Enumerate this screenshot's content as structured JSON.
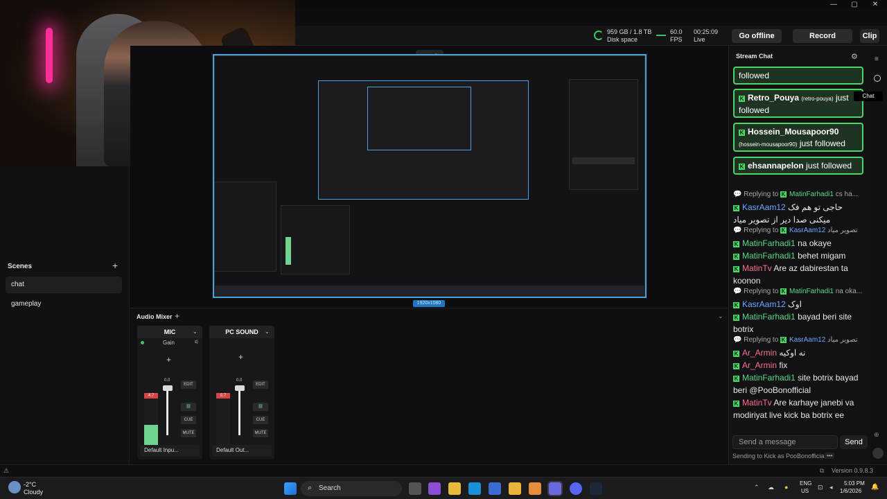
{
  "window": {
    "minimize": "—",
    "maximize": "▢",
    "close": "✕"
  },
  "toolbar": {
    "disk_value": "959 GB / 1.8 TB",
    "disk_label": "Disk space",
    "fps_value": "60.0",
    "fps_label": "FPS",
    "time_value": "00:25:09",
    "time_label": "Live",
    "go_offline": "Go offline",
    "record": "Record",
    "clip": "Clip"
  },
  "scenes": {
    "title": "Scenes",
    "add": "+",
    "items": [
      {
        "label": "chat"
      },
      {
        "label": "gameplay"
      }
    ]
  },
  "preview": {
    "resolution": "1920x1080"
  },
  "mixer": {
    "title": "Audio Mixer",
    "add": "+",
    "collapse": "⌄",
    "strips": [
      {
        "name": "MIC",
        "gain": "Gain",
        "add": "+",
        "peak": "4.7",
        "level": "0.0",
        "edit": "EDIT",
        "cue": "CUE",
        "mute": "MUTE",
        "device": "Default Inpu...",
        "meter_fill": 0.52
      },
      {
        "name": "PC SOUND",
        "add": "+",
        "peak": "0.7",
        "level": "0.0",
        "edit": "EDIT",
        "cue": "CUE",
        "mute": "MUTE",
        "device": "Default Out...",
        "meter_fill": 0.05
      }
    ]
  },
  "chat": {
    "title": "Stream Chat",
    "tooltip": "Chat",
    "follows": [
      {
        "tail": "followed"
      },
      {
        "user": "Retro_Pouya",
        "handle": "(retro-pouya)",
        "tail": "just followed"
      },
      {
        "user": "Hossein_Mousapoor90",
        "handle": "(hossein-mousapoor90)",
        "tail": "just followed"
      },
      {
        "user": "ehsannapelon",
        "tail": "just followed"
      }
    ],
    "messages": [
      {
        "reply_to": "MatinFarhadi1",
        "reply_text": "cs ha..."
      },
      {
        "user": "KasrAam12",
        "text": "حاجی تو هم فک میکنی صدا دیر از تصویر میاد"
      },
      {
        "reply_to": "KasrAam12",
        "reply_text": "تصویر میاد"
      },
      {
        "user": "MatinFarhadi1",
        "text": "na okaye"
      },
      {
        "user": "MatinFarhadi1",
        "text": "behet migam"
      },
      {
        "user": "MatinTv",
        "text": "Are az dabirestan ta koonon"
      },
      {
        "reply_to": "MatinFarhadi1",
        "reply_text": "na oka..."
      },
      {
        "user": "KasrAam12",
        "text": "اوک"
      },
      {
        "user": "MatinFarhadi1",
        "text": "bayad beri site botrix"
      },
      {
        "reply_to": "KasrAam12",
        "reply_text": "تصویر میاد"
      },
      {
        "user": "Ar_Armin",
        "text": "نه اوکیه"
      },
      {
        "user": "Ar_Armin",
        "text": "fix"
      },
      {
        "user": "MatinFarhadi1",
        "text": "site botrix bayad beri @PooBonofficial"
      },
      {
        "user": "MatinTv",
        "text": "Are karhaye janebi va modiriyat live kick ba botrix ee"
      }
    ],
    "replying_label": "Replying to",
    "input_placeholder": "Send a message",
    "send": "Send",
    "sending_as": "Sending to Kick as PooBonofficial.",
    "more": "•••"
  },
  "status": {
    "version": "Version 0.9.8.3"
  },
  "taskbar": {
    "weather_temp": "-2°C",
    "weather_desc": "Cloudy",
    "search": "Search",
    "lang1": "ENG",
    "lang2": "US",
    "time": "5:03 PM",
    "date": "1/6/2026"
  },
  "colors": {
    "accent": "#4aa3df",
    "kick_green": "#4bd864",
    "live_green": "#3fc26a"
  }
}
